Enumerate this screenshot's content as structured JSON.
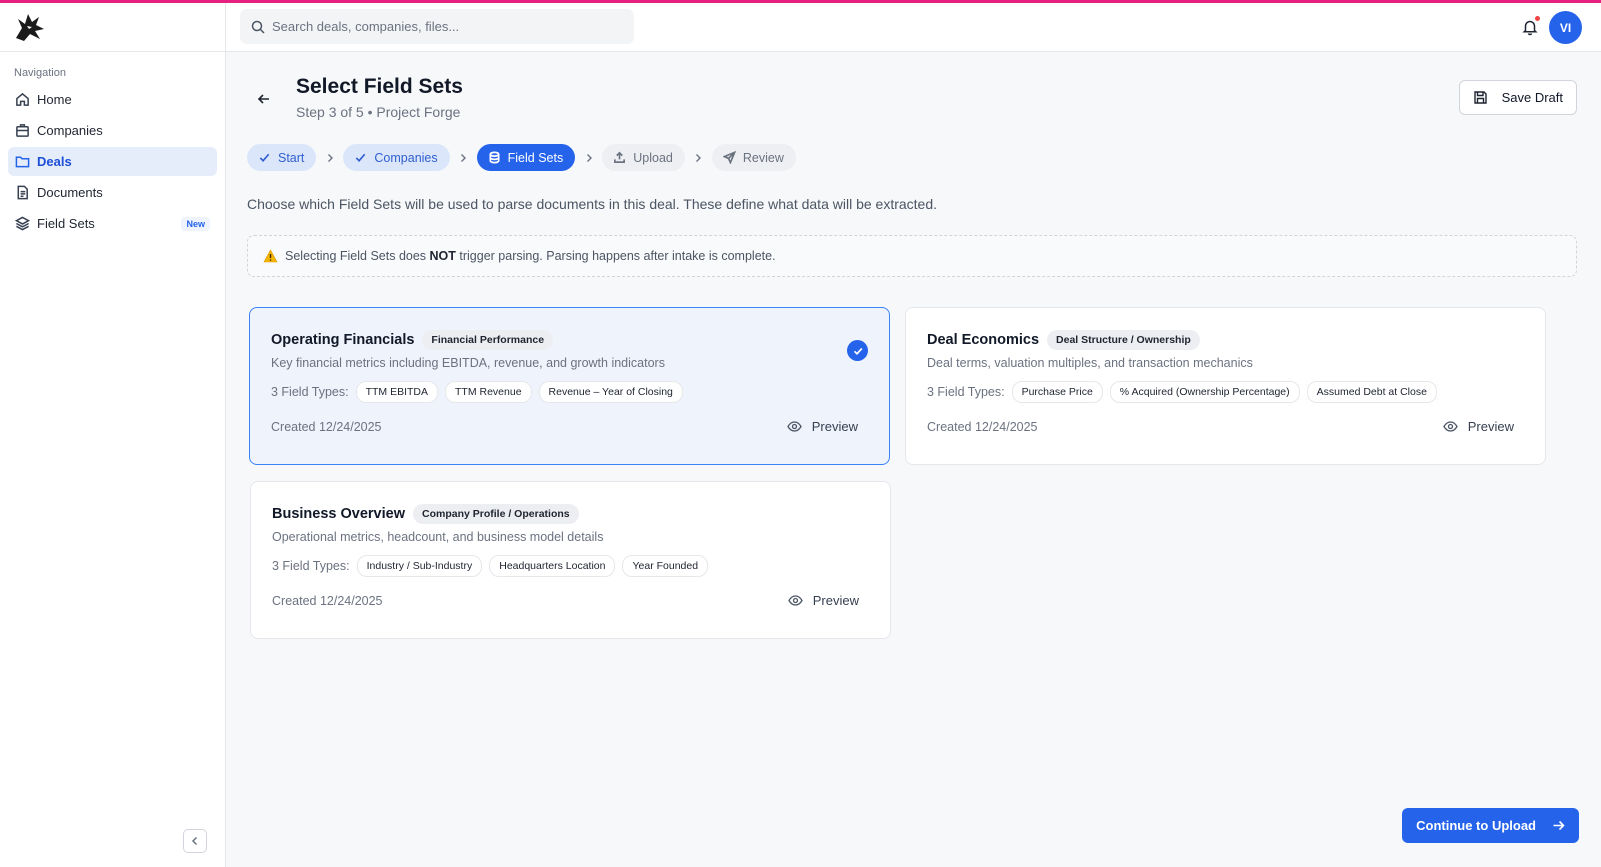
{
  "sidebar": {
    "heading": "Navigation",
    "items": [
      {
        "label": "Home",
        "icon": "home-icon"
      },
      {
        "label": "Companies",
        "icon": "building-icon"
      },
      {
        "label": "Deals",
        "icon": "folder-icon",
        "active": true
      },
      {
        "label": "Documents",
        "icon": "document-icon"
      },
      {
        "label": "Field Sets",
        "icon": "layers-icon",
        "badge": "New"
      }
    ]
  },
  "topbar": {
    "search_placeholder": "Search deals, companies, files...",
    "avatar_initials": "VI"
  },
  "page": {
    "title": "Select Field Sets",
    "subtitle": "Step 3 of 5 • Project Forge",
    "save_draft_label": "Save Draft",
    "intro": "Choose which Field Sets will be used to parse documents in this deal. These define what data will be extracted.",
    "notice_pre": "Selecting Field Sets does ",
    "notice_bold": "NOT",
    "notice_post": " trigger parsing. Parsing happens after intake is complete.",
    "continue_label": "Continue to Upload"
  },
  "steps": [
    {
      "label": "Start",
      "state": "done"
    },
    {
      "label": "Companies",
      "state": "done"
    },
    {
      "label": "Field Sets",
      "state": "current"
    },
    {
      "label": "Upload",
      "state": "pending"
    },
    {
      "label": "Review",
      "state": "pending"
    }
  ],
  "cards": [
    {
      "title": "Operating Financials",
      "category": "Financial Performance",
      "description": "Key financial metrics including EBITDA, revenue, and growth indicators",
      "field_types_label": "3 Field Types:",
      "fields": [
        "TTM EBITDA",
        "TTM Revenue",
        "Revenue – Year of Closing"
      ],
      "created": "Created 12/24/2025",
      "preview_label": "Preview",
      "selected": true
    },
    {
      "title": "Deal Economics",
      "category": "Deal Structure / Ownership",
      "description": "Deal terms, valuation multiples, and transaction mechanics",
      "field_types_label": "3 Field Types:",
      "fields": [
        "Purchase Price",
        "% Acquired (Ownership Percentage)",
        "Assumed Debt at Close"
      ],
      "created": "Created 12/24/2025",
      "preview_label": "Preview",
      "selected": false
    },
    {
      "title": "Business Overview",
      "category": "Company Profile / Operations",
      "description": "Operational metrics, headcount, and business model details",
      "field_types_label": "3 Field Types:",
      "fields": [
        "Industry / Sub-Industry",
        "Headquarters Location",
        "Year Founded"
      ],
      "created": "Created 12/24/2025",
      "preview_label": "Preview",
      "selected": false
    }
  ],
  "colors": {
    "accent": "#2563eb",
    "top_line": "#e6207f",
    "selected_card_bg": "#eef3fc",
    "notification_dot": "#ef4444"
  }
}
